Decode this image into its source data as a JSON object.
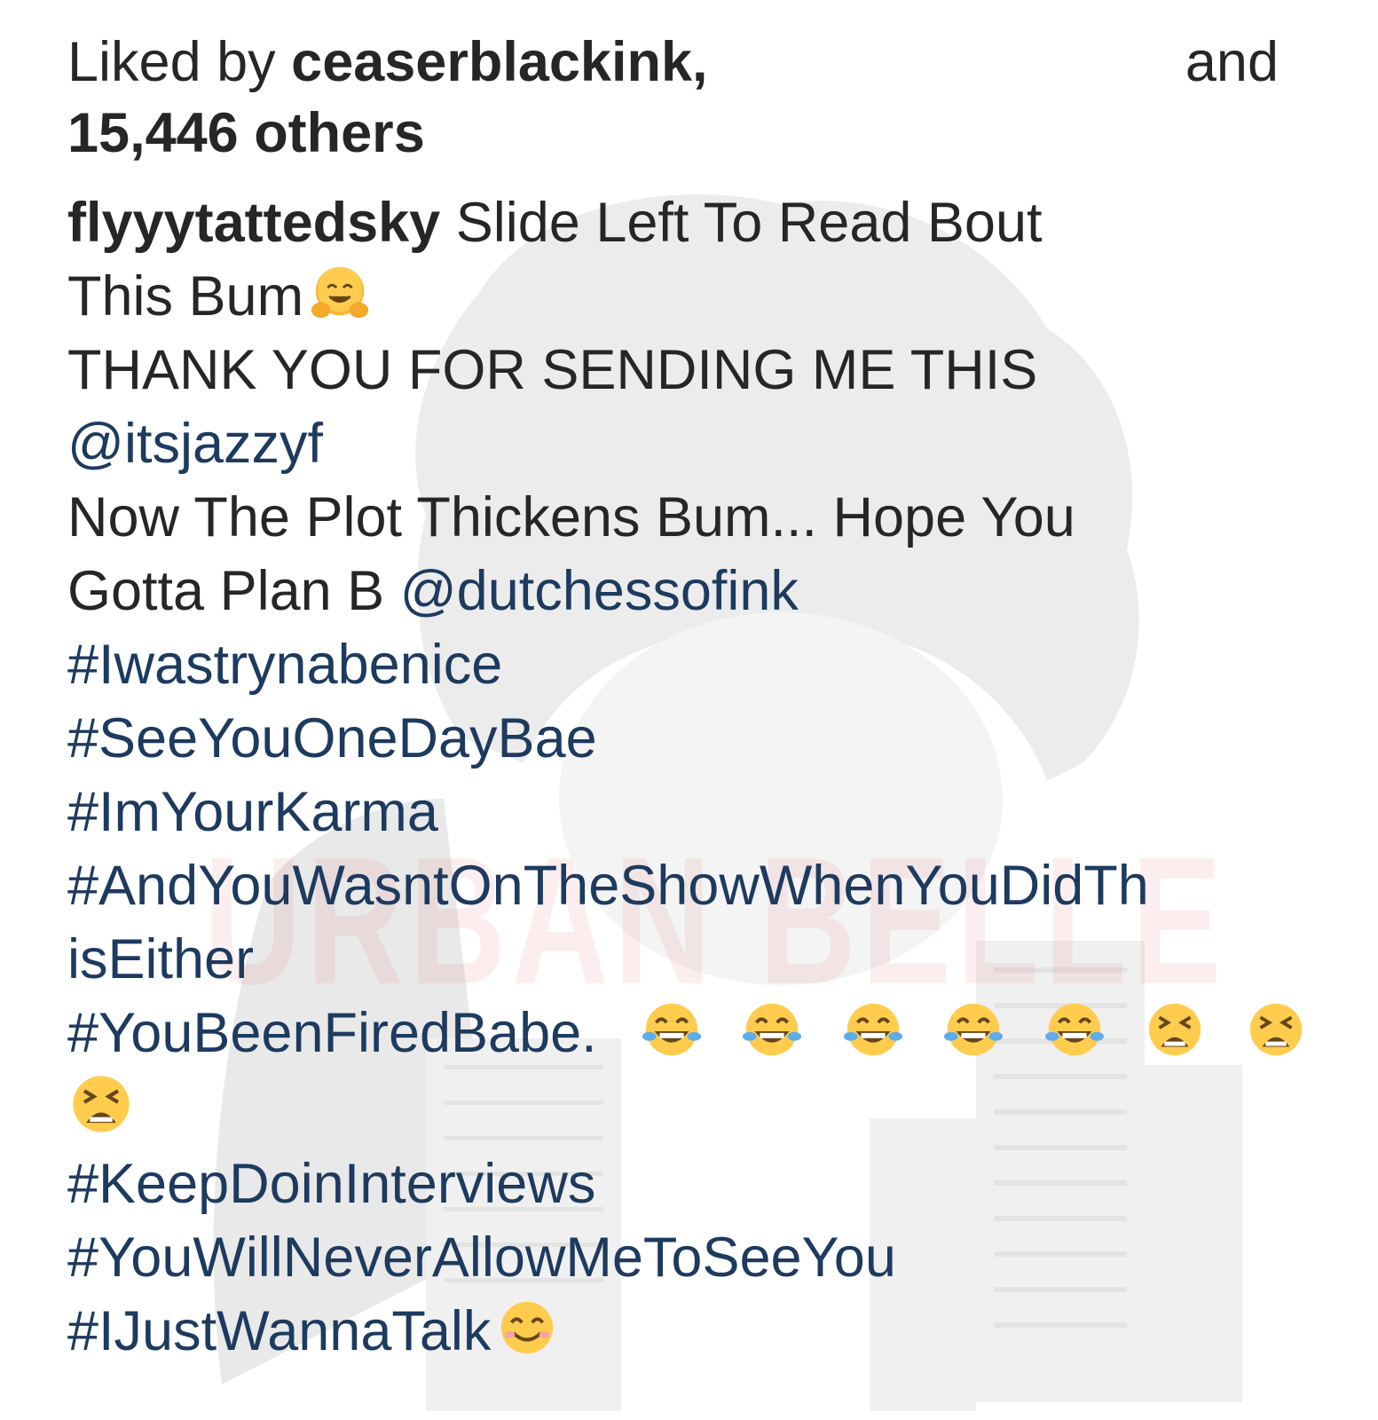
{
  "likes": {
    "prefix": "Liked by ",
    "first_user": "ceaserblackink,",
    "and": "and",
    "others": "15,446 others"
  },
  "caption": {
    "username": "flyyytattedsky",
    "line1_text": " Slide Left To Read Bout",
    "line2_text": "This Bum",
    "line3_text": "THANK YOU FOR SENDING ME THIS",
    "mention1": "@itsjazzyf",
    "line5_text": "Now The Plot Thickens Bum... Hope You",
    "line6_text": "Gotta Plan B ",
    "mention2": "@dutchessofink",
    "hashtags": {
      "h1": "#Iwastrynabenice",
      "h2": "#SeeYouOneDayBae",
      "h3": "#ImYourKarma",
      "h4a": "#AndYouWasntOnTheShowWhenYouDidTh",
      "h4b": "isEither",
      "h5": "#YouBeenFiredBabe.",
      "h6": "#KeepDoinInterviews",
      "h7": "#YouWillNeverAllowMeToSeeYou",
      "h8": "#IJustWannaTalk"
    }
  },
  "emojis": {
    "hug": "hugging-face-emoji",
    "laugh": "tears-of-joy-emoji",
    "tired": "tired-face-emoji",
    "smile": "smiling-face-emoji"
  },
  "watermark": {
    "text": "URBAN BELLE"
  },
  "colors": {
    "text": "#262626",
    "link": "#1d3a5f",
    "watermark": "#e6788250"
  }
}
